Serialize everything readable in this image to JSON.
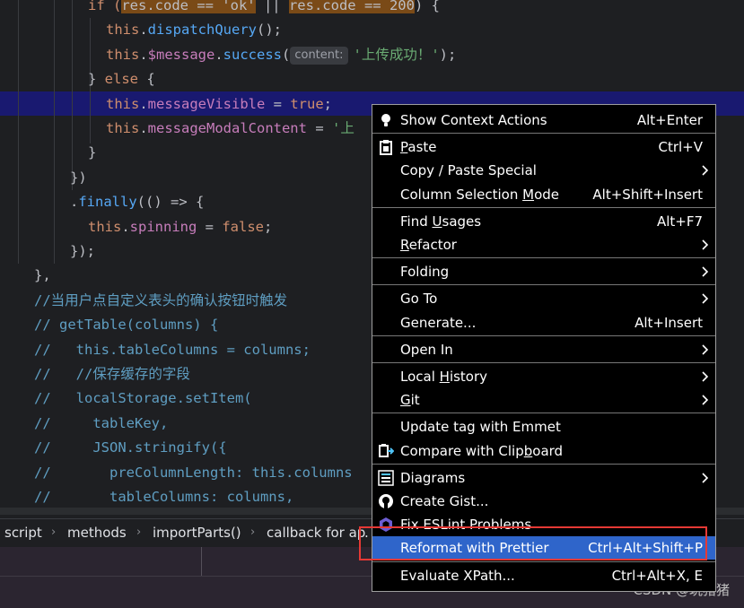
{
  "editor": {
    "lines": [
      {
        "segments": [
          {
            "t": "if (",
            "c": "kw"
          },
          {
            "t": "res.code == 'ok'",
            "c": "ph"
          },
          {
            "t": " || ",
            "c": ""
          },
          {
            "t": "res.code == 200",
            "c": "ph"
          },
          {
            "t": ") {",
            "c": ""
          }
        ]
      },
      {
        "segments": [
          {
            "t": "this",
            "c": "kw"
          },
          {
            "t": ".",
            "c": ""
          },
          {
            "t": "dispatchQuery",
            "c": "fn"
          },
          {
            "t": "();",
            "c": ""
          }
        ]
      },
      {
        "segments": [
          {
            "t": "this",
            "c": "kw"
          },
          {
            "t": ".",
            "c": ""
          },
          {
            "t": "$message",
            "c": "prop"
          },
          {
            "t": ".",
            "c": ""
          },
          {
            "t": "success",
            "c": "fn"
          },
          {
            "t": "(",
            "c": ""
          },
          {
            "t": "content:",
            "c": "hint"
          },
          {
            "t": "'上传成功！'",
            "c": "str"
          },
          {
            "t": ");",
            "c": ""
          }
        ]
      },
      {
        "segments": [
          {
            "t": "} ",
            "c": ""
          },
          {
            "t": "else",
            "c": "kw"
          },
          {
            "t": " {",
            "c": ""
          }
        ]
      },
      {
        "segments": [
          {
            "t": "this",
            "c": "kw"
          },
          {
            "t": ".",
            "c": ""
          },
          {
            "t": "messageVisible",
            "c": "prop"
          },
          {
            "t": " = ",
            "c": ""
          },
          {
            "t": "true",
            "c": "kw"
          },
          {
            "t": ";",
            "c": ""
          }
        ]
      },
      {
        "segments": [
          {
            "t": "this",
            "c": "kw"
          },
          {
            "t": ".",
            "c": ""
          },
          {
            "t": "messageModalContent",
            "c": "prop"
          },
          {
            "t": " = ",
            "c": ""
          },
          {
            "t": "'上",
            "c": "str"
          }
        ]
      },
      {
        "segments": [
          {
            "t": "}",
            "c": ""
          }
        ]
      },
      {
        "segments": [
          {
            "t": "})",
            "c": ""
          }
        ]
      },
      {
        "segments": [
          {
            "t": ".",
            "c": ""
          },
          {
            "t": "finally",
            "c": "fn"
          },
          {
            "t": "(() => {",
            "c": ""
          }
        ]
      },
      {
        "segments": [
          {
            "t": "this",
            "c": "kw"
          },
          {
            "t": ".",
            "c": ""
          },
          {
            "t": "spinning",
            "c": "prop"
          },
          {
            "t": " = ",
            "c": ""
          },
          {
            "t": "false",
            "c": "kw"
          },
          {
            "t": ";",
            "c": ""
          }
        ]
      },
      {
        "segments": [
          {
            "t": "});",
            "c": ""
          }
        ]
      },
      {
        "segments": [
          {
            "t": "},",
            "c": ""
          }
        ]
      },
      {
        "segments": [
          {
            "t": "//当用户点自定义表头的确认按钮时触发",
            "c": "cmt"
          }
        ]
      },
      {
        "segments": [
          {
            "t": "// getTable(columns) {",
            "c": "cmt"
          }
        ]
      },
      {
        "segments": [
          {
            "t": "//   this.tableColumns = columns;",
            "c": "cmt"
          }
        ]
      },
      {
        "segments": [
          {
            "t": "//   //保存缓存的字段",
            "c": "cmt"
          }
        ]
      },
      {
        "segments": [
          {
            "t": "//   localStorage.setItem(",
            "c": "cmt"
          }
        ]
      },
      {
        "segments": [
          {
            "t": "//     tableKey,",
            "c": "cmt"
          }
        ]
      },
      {
        "segments": [
          {
            "t": "//     JSON.stringify({",
            "c": "cmt"
          }
        ]
      },
      {
        "segments": [
          {
            "t": "//       preColumnLength: this.columns",
            "c": "cmt"
          }
        ]
      },
      {
        "segments": [
          {
            "t": "//       tableColumns: columns,",
            "c": "cmt"
          }
        ]
      }
    ]
  },
  "breadcrumb": [
    "script",
    "methods",
    "importParts()",
    "callback for ap",
    "."
  ],
  "watermark": "CSDN @玩猪猪",
  "context_menu": {
    "groups": [
      [
        {
          "icon": "bulb-icon",
          "label": "Show Context Actions",
          "shortcut": "Alt+Enter"
        }
      ],
      [
        {
          "icon": "clipboard-icon",
          "label": "Paste",
          "u": "P",
          "shortcut": "Ctrl+V"
        },
        {
          "label": "Copy / Paste Special",
          "submenu": true
        },
        {
          "label": "Column Selection Mode",
          "u": "M",
          "shortcut": "Alt+Shift+Insert"
        }
      ],
      [
        {
          "label": "Find Usages",
          "u": "U",
          "shortcut": "Alt+F7"
        },
        {
          "label": "Refactor",
          "u": "R",
          "submenu": true
        }
      ],
      [
        {
          "label": "Folding",
          "submenu": true
        }
      ],
      [
        {
          "label": "Go To",
          "submenu": true
        },
        {
          "label": "Generate...",
          "shortcut": "Alt+Insert"
        }
      ],
      [
        {
          "label": "Open In",
          "submenu": true
        }
      ],
      [
        {
          "label": "Local History",
          "u": "H",
          "submenu": true
        },
        {
          "label": "Git",
          "u": "G",
          "submenu": true
        }
      ],
      [
        {
          "label": "Update tag with Emmet"
        },
        {
          "icon": "compare-clipboard-icon",
          "label": "Compare with Clipboard",
          "u": "b"
        }
      ],
      [
        {
          "icon": "diagrams-icon",
          "label": "Diagrams",
          "submenu": true
        },
        {
          "icon": "github-icon",
          "label": "Create Gist..."
        },
        {
          "icon": "eslint-icon",
          "label": "Fix ESLint Problems"
        },
        {
          "label": "Reformat with Prettier",
          "shortcut": "Ctrl+Alt+Shift+P",
          "active": true
        }
      ],
      [
        {
          "label": "Evaluate XPath...",
          "shortcut": "Ctrl+Alt+X, E"
        }
      ]
    ]
  }
}
